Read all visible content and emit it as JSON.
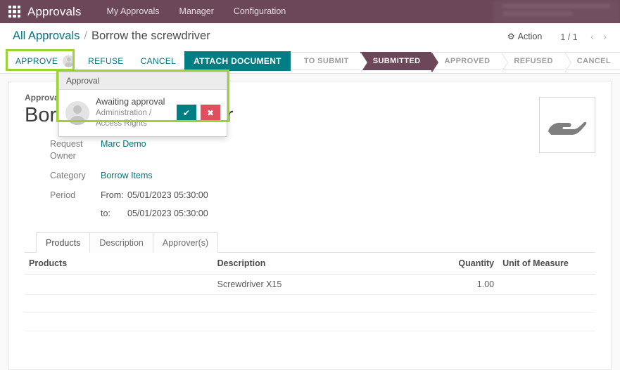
{
  "navbar": {
    "apps_icon": "apps-grid-icon",
    "brand": "Approvals",
    "menu": [
      {
        "label": "My Approvals"
      },
      {
        "label": "Manager"
      },
      {
        "label": "Configuration"
      }
    ]
  },
  "control_panel": {
    "breadcrumb": {
      "root": "All Approvals",
      "separator": "/",
      "current": "Borrow the screwdriver"
    },
    "action_label": "Action",
    "action_icon": "gear-icon",
    "pager": {
      "value": "1 / 1",
      "prev_icon": "chevron-left-icon",
      "next_icon": "chevron-right-icon"
    },
    "buttons": [
      {
        "label": "APPROVE",
        "style": "link",
        "name": "approve-button"
      },
      {
        "label": "REFUSE",
        "style": "link",
        "name": "refuse-button"
      },
      {
        "label": "CANCEL",
        "style": "link",
        "name": "cancel-button"
      },
      {
        "label": "ATTACH DOCUMENT",
        "style": "primary",
        "name": "attach-document-button"
      }
    ],
    "statusbar": [
      {
        "label": "TO SUBMIT",
        "active": false
      },
      {
        "label": "SUBMITTED",
        "active": true
      },
      {
        "label": "APPROVED",
        "active": false
      },
      {
        "label": "REFUSED",
        "active": false
      },
      {
        "label": "CANCEL",
        "active": false
      }
    ]
  },
  "popover": {
    "header": "Approval",
    "status": "Awaiting approval",
    "group": "Administration / Access Rights",
    "approve_icon": "check-icon",
    "refuse_icon": "cross-icon",
    "avatar_icon": "user-avatar-icon"
  },
  "form": {
    "subject_label": "Approval Subject",
    "title": "Borrow the screwdriver",
    "category_image_icon": "borrow-hand-icon",
    "fields": [
      {
        "label": "Request Owner",
        "value": "Marc Demo",
        "link": true
      },
      {
        "label": "Category",
        "value": "Borrow Items",
        "link": true
      }
    ],
    "period": {
      "label": "Period",
      "from_key": "From:",
      "from_value": "05/01/2023 05:30:00",
      "to_key": "to:",
      "to_value": "05/01/2023 05:30:00"
    },
    "tabs": [
      {
        "label": "Products",
        "active": true
      },
      {
        "label": "Description",
        "active": false
      },
      {
        "label": "Approver(s)",
        "active": false
      }
    ],
    "table": {
      "headers": [
        "Products",
        "Description",
        "Quantity",
        "Unit of Measure"
      ],
      "rows": [
        {
          "products": "",
          "description": "Screwdriver X15",
          "quantity": "1.00",
          "uom": ""
        },
        {
          "products": "",
          "description": "",
          "quantity": "",
          "uom": ""
        },
        {
          "products": "",
          "description": "",
          "quantity": "",
          "uom": ""
        }
      ]
    }
  },
  "annotations": {
    "approve_highlight": "approve-button-highlight",
    "popover_highlight": "approval-popover-highlight",
    "color": "#9ad333"
  }
}
